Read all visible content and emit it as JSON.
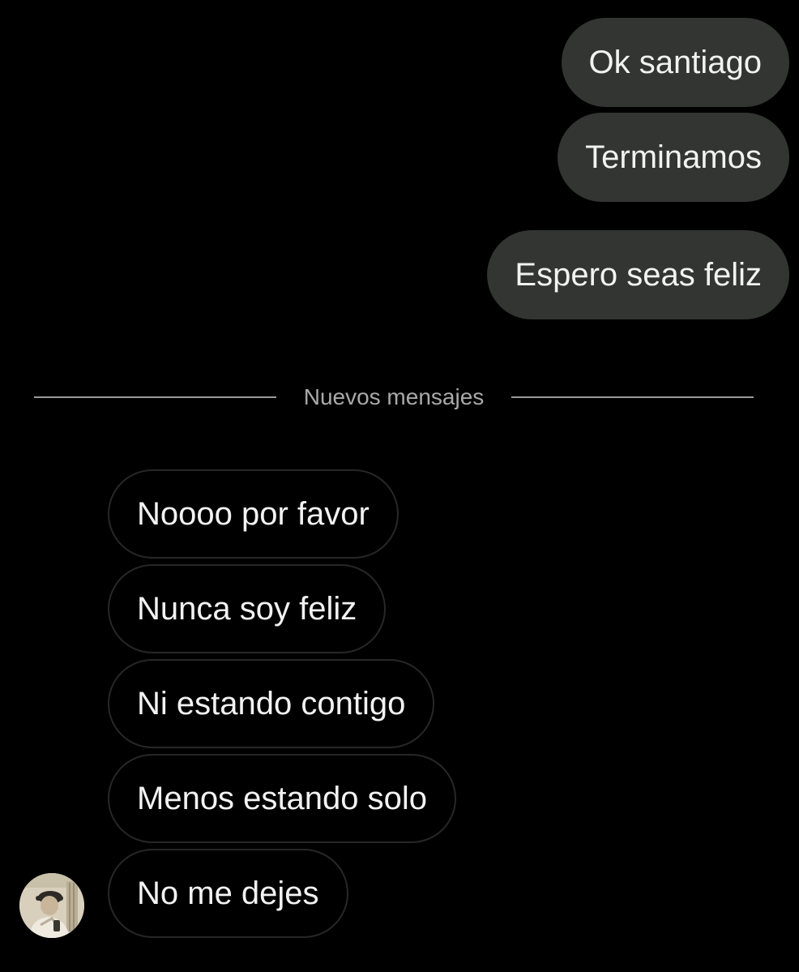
{
  "sent_messages": [
    {
      "text": "Ok santiago"
    },
    {
      "text": "Terminamos"
    },
    {
      "text": "Espero seas feliz"
    }
  ],
  "divider": {
    "label": "Nuevos mensajes"
  },
  "received_messages": [
    {
      "text": "Noooo por favor"
    },
    {
      "text": "Nunca soy feliz"
    },
    {
      "text": "Ni estando contigo"
    },
    {
      "text": "Menos estando solo"
    },
    {
      "text": "No me dejes"
    }
  ],
  "colors": {
    "background": "#000000",
    "sent_bubble": "#323532",
    "received_border": "#262826",
    "text": "#f2f2f2",
    "divider": "#9a9a9a"
  },
  "contact": {
    "avatar_icon": "profile-photo"
  }
}
